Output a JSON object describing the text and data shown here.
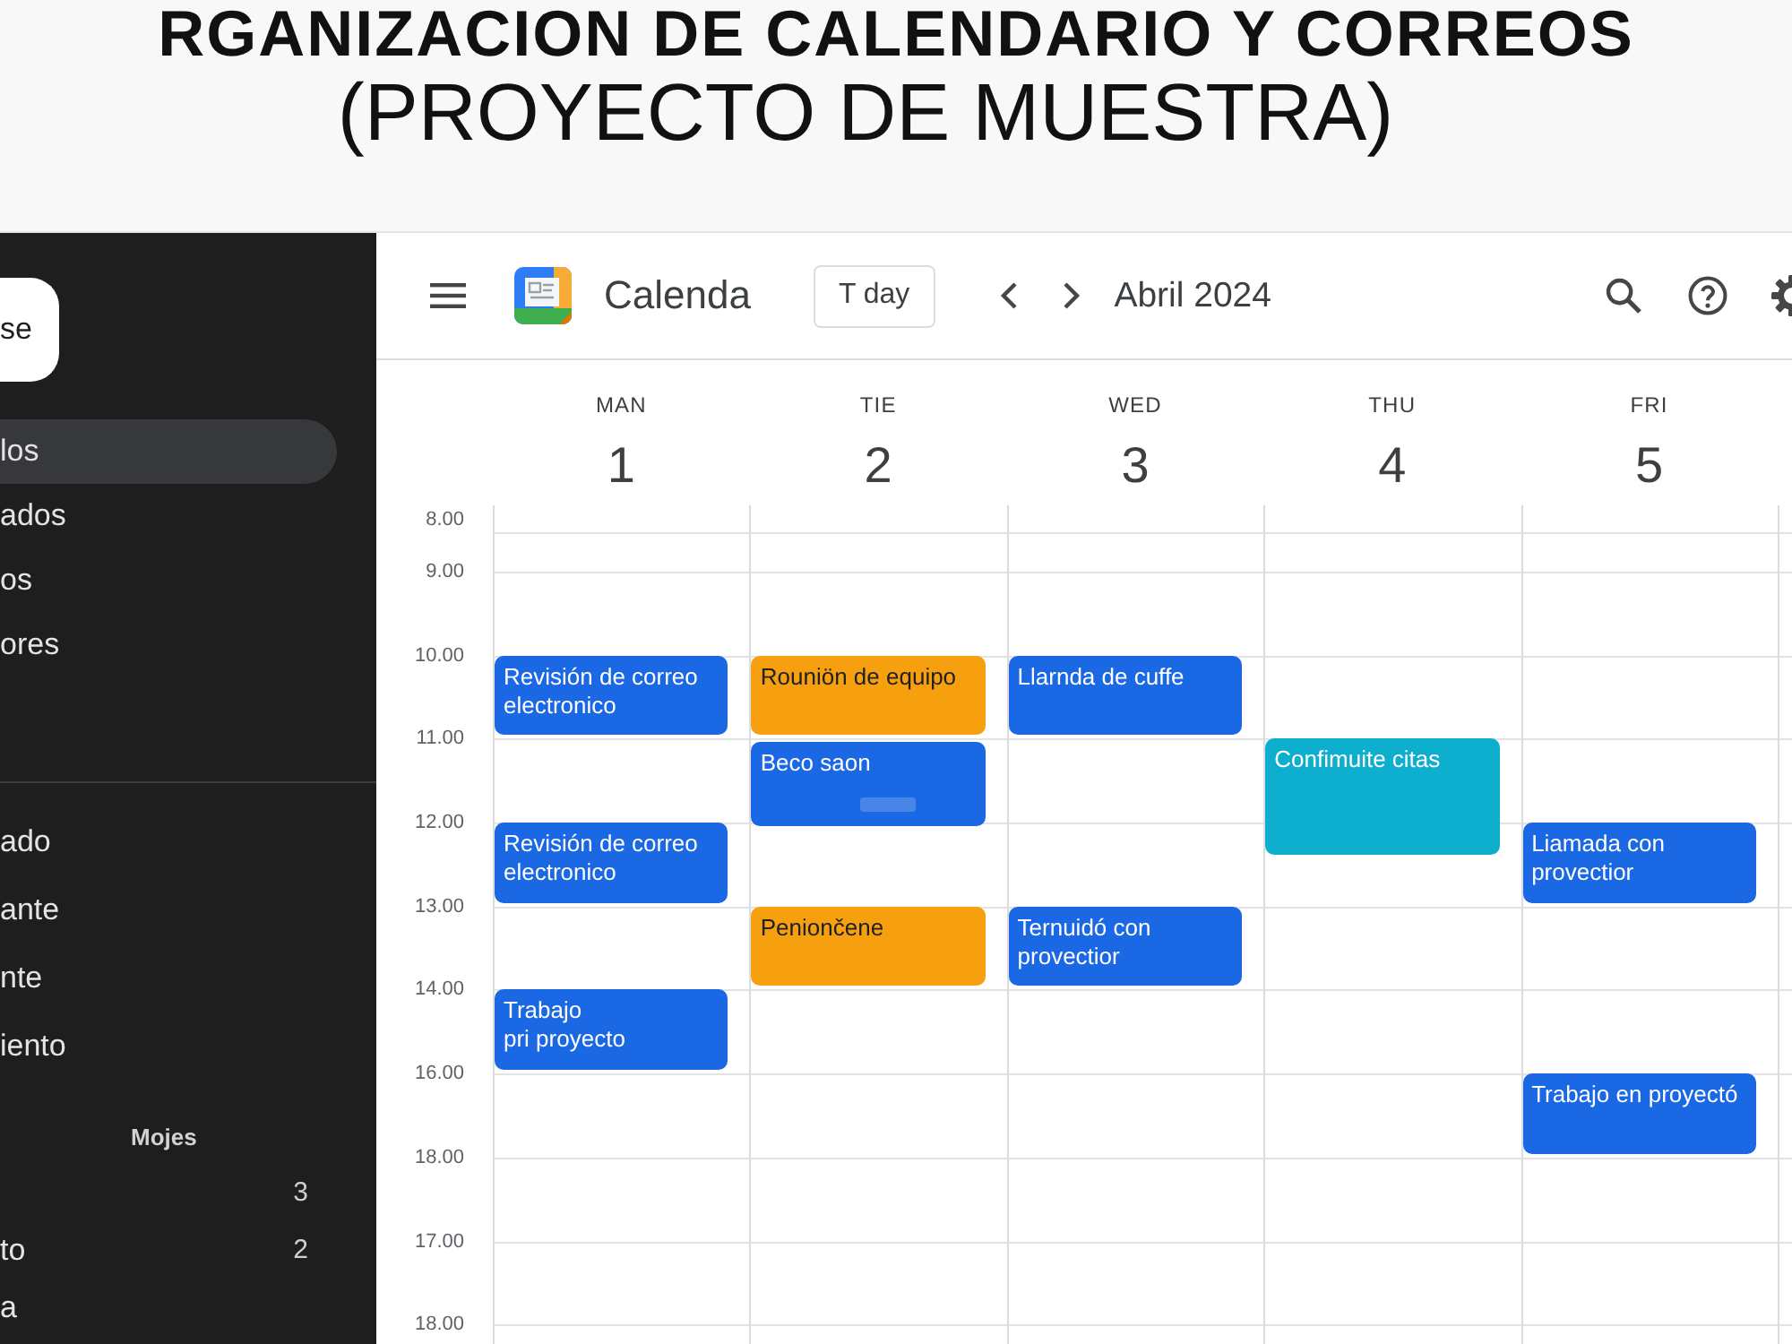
{
  "banner": {
    "title": "RGANIZACION DE CALENDARIO Y CORREOS",
    "subtitle": "(PROYECTO DE MUESTRA)"
  },
  "sidebar": {
    "button": "se",
    "nav_items": [
      {
        "label": "los",
        "selected": true
      },
      {
        "label": "ados",
        "selected": false
      },
      {
        "label": "os",
        "selected": false
      },
      {
        "label": "ores",
        "selected": false
      }
    ],
    "labels": [
      "ado",
      "ante",
      "nte",
      "iento"
    ],
    "section": {
      "title": "Mojes",
      "items": [
        {
          "count": "3"
        },
        {
          "label": "to",
          "count": "2"
        },
        {
          "label": "a"
        }
      ]
    }
  },
  "toolbar": {
    "app_name": "Calenda",
    "today_button": "T day",
    "month": "Abril 2024"
  },
  "calendar": {
    "days": [
      {
        "name": "MAN",
        "date": "1"
      },
      {
        "name": "TIE",
        "date": "2"
      },
      {
        "name": "WED",
        "date": "3"
      },
      {
        "name": "THU",
        "date": "4"
      },
      {
        "name": "FRI",
        "date": "5"
      }
    ],
    "rows": [
      {
        "time": "8.00"
      },
      {
        "time": "9.00"
      },
      {
        "time": "10.00",
        "cells": [
          {
            "event": {
              "title": "Revisión de correo electronico",
              "color": "#1a68e3",
              "kind": "standard"
            }
          },
          {
            "event": {
              "title": "Rouniön de equipo",
              "color": "#f7a00f",
              "kind": "standard"
            }
          },
          {
            "event": {
              "title": "Llarnda de cuffe",
              "color": "#1a68e3",
              "kind": "standard"
            }
          },
          {},
          {}
        ]
      },
      {
        "time": "11.00",
        "cells": [
          {},
          {
            "event": {
              "title": "Beco saon",
              "color": "#1a68e3",
              "kind": "marked"
            }
          },
          {},
          {
            "event": {
              "title": "Confimuite citas",
              "color": "#0eaecf",
              "kind": "tall"
            }
          },
          {}
        ]
      },
      {
        "time": "12.00",
        "cells": [
          {
            "event": {
              "title": "Revisión de correo electronico",
              "color": "#1a68e3",
              "kind": "standard"
            }
          },
          {},
          {},
          {},
          {
            "event": {
              "title": "Liamada con provectior",
              "color": "#1a68e3",
              "kind": "standard"
            }
          }
        ]
      },
      {
        "time": "13.00",
        "cells": [
          {},
          {
            "event": {
              "title": "Peniončene",
              "color": "#f7a00f",
              "kind": "standard"
            }
          },
          {
            "event": {
              "title": "Ternuidó con provectior",
              "color": "#1a68e3",
              "kind": "standard"
            }
          },
          {},
          {}
        ]
      },
      {
        "time": "14.00",
        "cells": [
          {
            "event": {
              "title": "Trabajo\npri proyecto",
              "color": "#1a68e3",
              "kind": "standard"
            }
          },
          {},
          {},
          {},
          {}
        ]
      },
      {
        "time": "16.00",
        "cells": [
          {},
          {},
          {},
          {},
          {
            "event": {
              "title": "Trabajo en proyectó",
              "color": "#1a68e3",
              "kind": "standard"
            }
          }
        ]
      },
      {
        "time": "18.00"
      },
      {
        "time": "17.00"
      },
      {
        "time": "18.00"
      }
    ]
  }
}
